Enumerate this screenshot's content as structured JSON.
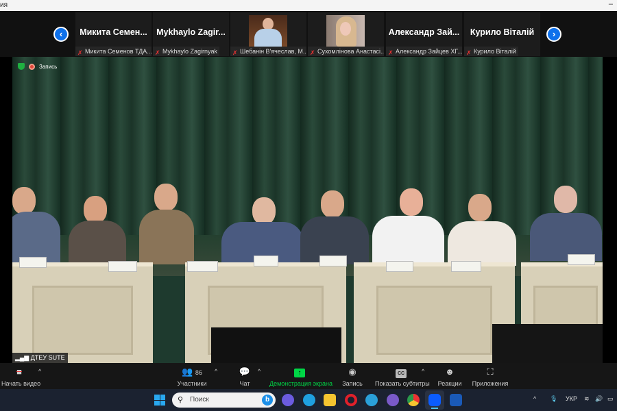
{
  "window": {
    "title_fragment": "ия"
  },
  "participants_strip": {
    "prev_label": "‹",
    "next_label": "›",
    "tiles": [
      {
        "display": "Микита  Семен...",
        "name": "Микита Семенов ТДА...",
        "has_photo": false
      },
      {
        "display": "Mykhaylo  Zagir...",
        "name": "Mykhaylo Zagirnyak",
        "has_photo": false
      },
      {
        "display": "",
        "name": "Шебанін В'ячеслав, М...",
        "has_photo": true
      },
      {
        "display": "",
        "name": "Сухомлінова Анастасі...",
        "has_photo": true
      },
      {
        "display": "Александр  Зай...",
        "name": "Александр Зайцев ХГ...",
        "has_photo": false
      },
      {
        "display": "Курило Віталій",
        "name": "Курило Віталій",
        "has_photo": false
      }
    ]
  },
  "video": {
    "recording_label": "Запись",
    "speaker_label": "ДТЕУ SUTE"
  },
  "toolbar": {
    "start_video": "Начать видео",
    "participants": "Участники",
    "participants_count": "86",
    "chat": "Чат",
    "share_screen": "Демонстрация экрана",
    "record": "Запись",
    "captions": "Показать субтитры",
    "captions_icon": "CC",
    "reactions": "Реакции",
    "apps": "Приложения"
  },
  "taskbar": {
    "search_placeholder": "Поиск",
    "language": "УКР"
  },
  "colors": {
    "accent": "#0e71eb",
    "share_green": "#00d646",
    "muted_red": "#e33333"
  }
}
